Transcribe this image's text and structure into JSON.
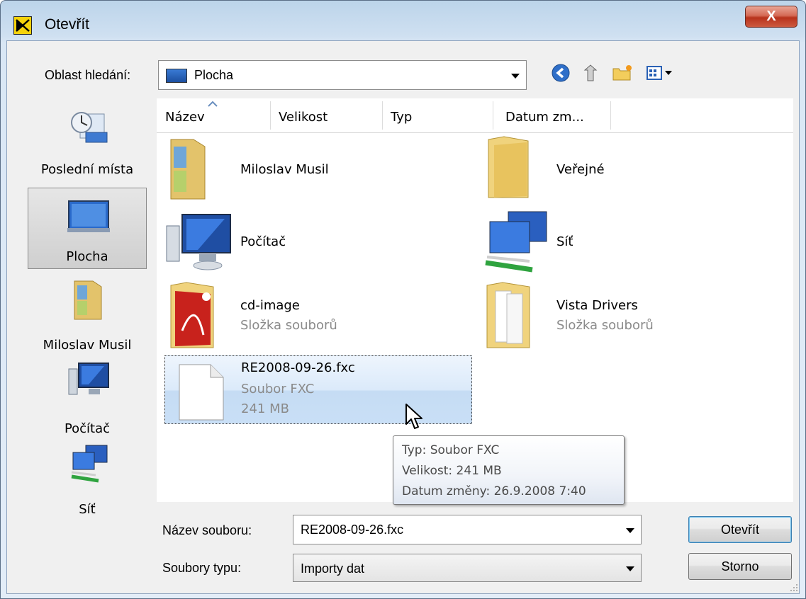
{
  "window": {
    "title": "Otevřít",
    "close_glyph": "X"
  },
  "lookin": {
    "label": "Oblast hledání:",
    "value": "Plocha"
  },
  "toolbar": {
    "icons": [
      "back-icon",
      "up-folder-icon",
      "new-folder-icon",
      "views-menu-icon"
    ]
  },
  "places": [
    {
      "label": "Poslední místa",
      "icon": "recent-places-icon"
    },
    {
      "label": "Plocha",
      "icon": "desktop-icon",
      "selected": true
    },
    {
      "label": "Miloslav Musil",
      "icon": "user-folder-icon"
    },
    {
      "label": "Počítač",
      "icon": "computer-icon"
    },
    {
      "label": "Síť",
      "icon": "network-icon"
    }
  ],
  "columns": [
    "Název",
    "Velikost",
    "Typ",
    "Datum zm..."
  ],
  "items": [
    {
      "name": "Miloslav Musil",
      "sub": []
    },
    {
      "name": "Veřejné",
      "sub": []
    },
    {
      "name": "Počítač",
      "sub": []
    },
    {
      "name": "Síť",
      "sub": []
    },
    {
      "name": "cd-image",
      "sub": [
        "Složka souborů"
      ]
    },
    {
      "name": "Vista Drivers",
      "sub": [
        "Složka souborů"
      ]
    },
    {
      "name": "RE2008-09-26.fxc",
      "sub": [
        "Soubor FXC",
        "241 MB"
      ]
    }
  ],
  "tooltip": {
    "lines": [
      "Typ: Soubor FXC",
      "Velikost: 241 MB",
      "Datum změny: 26.9.2008 7:40"
    ]
  },
  "filename": {
    "label": "Název souboru:",
    "value": "RE2008-09-26.fxc"
  },
  "filetype": {
    "label": "Soubory typu:",
    "value": "Importy dat"
  },
  "buttons": {
    "open": "Otevřít",
    "cancel": "Storno"
  },
  "colors": {
    "selection": "#c9dff6",
    "title_bar": "#bcd4ea",
    "close_button": "#c63d24"
  }
}
